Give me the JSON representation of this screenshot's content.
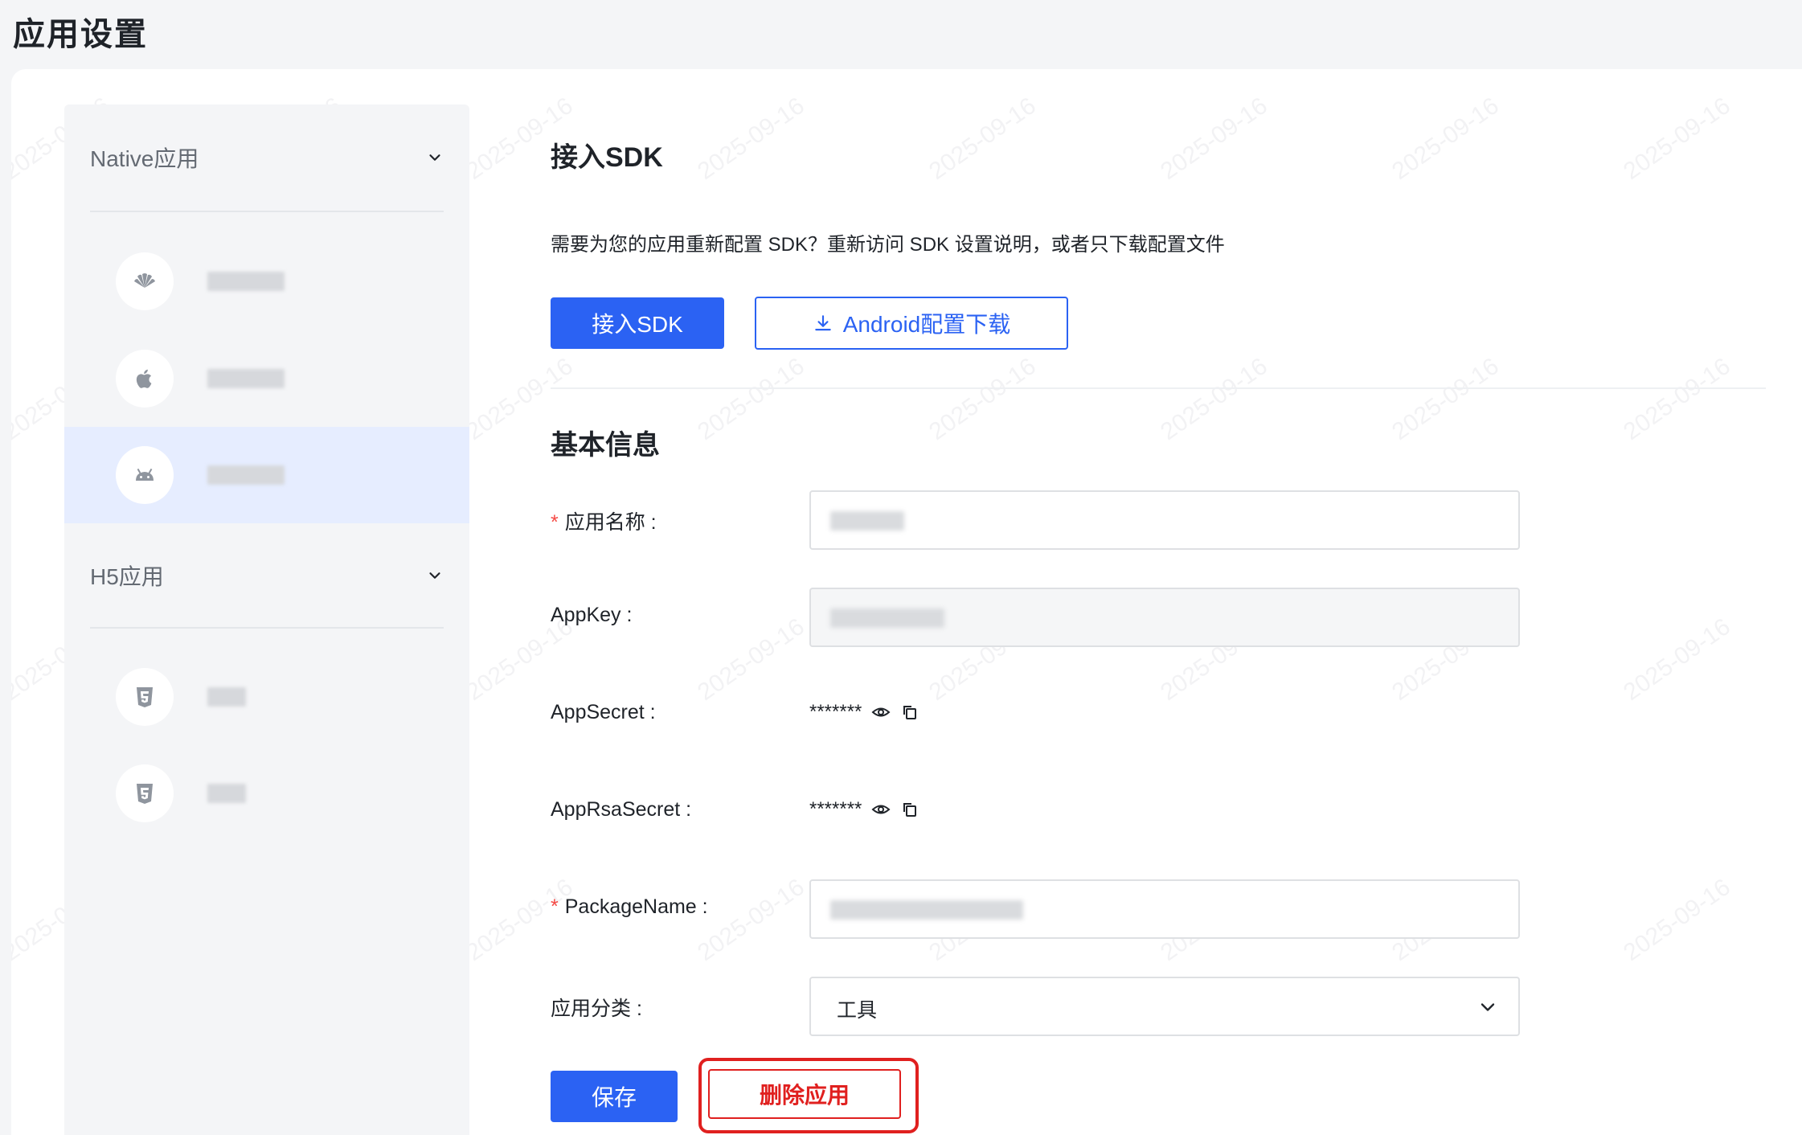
{
  "page": {
    "title": "应用设置"
  },
  "watermark": {
    "text": "2025-09-16"
  },
  "sidebar": {
    "native_group": {
      "title": "Native应用"
    },
    "native_apps": [
      {
        "icon": "huawei-icon",
        "name_blurred": true
      },
      {
        "icon": "apple-icon",
        "name_blurred": true
      },
      {
        "icon": "android-icon",
        "name_blurred": true,
        "active": true
      }
    ],
    "h5_group": {
      "title": "H5应用"
    },
    "h5_apps": [
      {
        "icon": "html5-icon",
        "name_blurred": true
      },
      {
        "icon": "html5-icon",
        "name_blurred": true
      }
    ]
  },
  "sdk_section": {
    "title": "接入SDK",
    "description": "需要为您的应用重新配置 SDK？重新访问 SDK 设置说明，或者只下载配置文件",
    "connect_button": "接入SDK",
    "download_button": "Android配置下载"
  },
  "basic_info": {
    "title": "基本信息",
    "app_name_label": "应用名称 :",
    "app_key_label": "AppKey :",
    "app_secret_label": "AppSecret :",
    "app_secret_value": "*******",
    "app_rsa_secret_label": "AppRsaSecret :",
    "app_rsa_secret_value": "*******",
    "package_name_label": "PackageName :",
    "category_label": "应用分类 :",
    "category_value": "工具",
    "required_mark": "*"
  },
  "actions": {
    "save_button": "保存",
    "delete_button": "删除应用"
  },
  "colors": {
    "primary": "#2b62f3",
    "danger": "#e0201f",
    "sidebar_bg": "#f4f5f7",
    "active_item_bg": "#e6edff"
  }
}
